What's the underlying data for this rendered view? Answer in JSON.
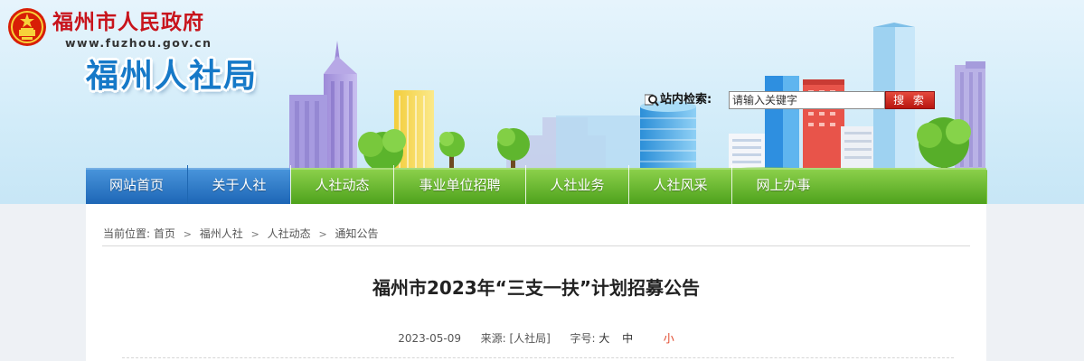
{
  "header": {
    "gov_name": "福州市人民政府",
    "gov_url": "www.fuzhou.gov.cn",
    "bureau_name": "福州人社局",
    "logo_icon": "national-emblem-icon"
  },
  "search": {
    "label": "站内检索:",
    "placeholder": "请输入关键字",
    "button_label": "搜 索",
    "icon": "magnifier-icon"
  },
  "nav": {
    "items": [
      {
        "label": "网站首页"
      },
      {
        "label": "关于人社"
      },
      {
        "label": "人社动态"
      },
      {
        "label": "事业单位招聘"
      },
      {
        "label": "人社业务"
      },
      {
        "label": "人社风采"
      },
      {
        "label": "网上办事"
      }
    ]
  },
  "breadcrumb": {
    "prefix": "当前位置:",
    "items": [
      "首页",
      "福州人社",
      "人社动态",
      "通知公告"
    ],
    "separator": ">"
  },
  "article": {
    "title": "福州市2023年“三支一扶”计划招募公告",
    "date": "2023-05-09",
    "source_label": "来源:",
    "source": "[人社局]",
    "font_label": "字号:",
    "font_sizes": [
      "大",
      "中",
      "小"
    ]
  },
  "colors": {
    "gov_red": "#c8141c",
    "bureau_blue": "#1679c8",
    "nav_blue": "#2d7ccb",
    "nav_green": "#6cbd2e",
    "active_size": "#e0462a"
  }
}
